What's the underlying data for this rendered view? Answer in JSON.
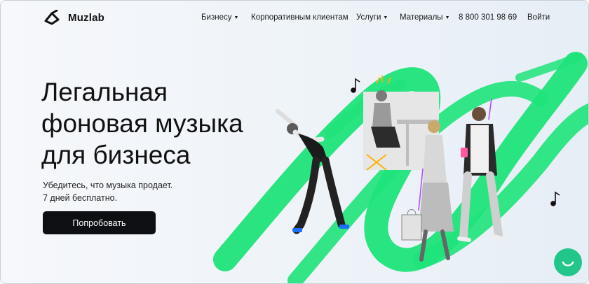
{
  "brand": {
    "name": "Muzlab"
  },
  "nav": {
    "items": [
      {
        "label": "Бизнесу",
        "has_dropdown": true
      },
      {
        "label": "Корпоративным клиентам",
        "has_dropdown": false
      },
      {
        "label": "Услуги",
        "has_dropdown": true
      },
      {
        "label": "Материалы",
        "has_dropdown": true
      },
      {
        "label": "8 800 301 98 69",
        "has_dropdown": false
      },
      {
        "label": "Войти",
        "has_dropdown": false
      }
    ]
  },
  "hero": {
    "title_lines": [
      "Легальная",
      "фоновая музыка",
      "для бизнеса"
    ],
    "subtitle_lines": [
      "Убедитесь, что музыка продает.",
      "7 дней бесплатно."
    ],
    "cta_label": "Попробовать"
  },
  "colors": {
    "accent_green": "#1ee37a",
    "chat_button": "#23c68a",
    "cta_background": "#0e0f12"
  },
  "icons": {
    "logo": "music-note-logo-icon",
    "dropdown": "caret-down-icon",
    "chat": "chat-smile-icon"
  }
}
